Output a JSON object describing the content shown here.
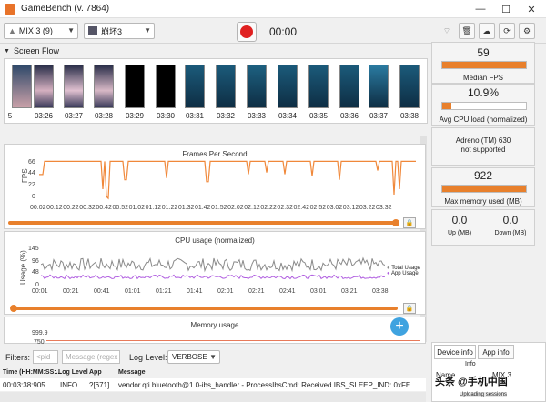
{
  "window": {
    "title": "GameBench (v. 7864)",
    "minimize": "—",
    "maximize": "☐",
    "close": "✕"
  },
  "toolbar": {
    "device": "MIX 3 (9)",
    "app": "崩坏3",
    "timer": "00:00",
    "icons": [
      "wifi-icon",
      "trash-icon",
      "upload-cloud-icon",
      "sync-icon",
      "settings-icon"
    ]
  },
  "screen_flow": {
    "label": "Screen Flow",
    "frames": [
      "5",
      "03:26",
      "03:27",
      "03:28",
      "03:29",
      "03:30",
      "03:31",
      "03:32",
      "03:33",
      "03:34",
      "03:35",
      "03:36",
      "03:37",
      "03:38"
    ]
  },
  "fps_chart": {
    "title": "Frames Per Second",
    "ylabel": "FPS",
    "y_ticks": [
      "66",
      "44",
      "22",
      "0"
    ],
    "x_ticks": [
      "00:02",
      "00:12",
      "00:22",
      "00:32",
      "00:42",
      "00:52",
      "01:02",
      "01:12",
      "01:22",
      "01:32",
      "01:42",
      "01:52",
      "02:02",
      "02:12",
      "02:22",
      "02:32",
      "02:42",
      "02:52",
      "03:02",
      "03:12",
      "03:22",
      "03:32"
    ]
  },
  "cpu_chart": {
    "title": "CPU usage (normalized)",
    "ylabel": "Usage (%)",
    "y_ticks": [
      "145",
      "96",
      "48",
      "0"
    ],
    "x_ticks": [
      "00:01",
      "00:21",
      "00:41",
      "01:01",
      "01:21",
      "01:41",
      "02:01",
      "02:21",
      "02:41",
      "03:01",
      "03:21",
      "03:38"
    ],
    "legend": [
      "Total Usage",
      "App Usage"
    ],
    "colors": {
      "total": "#8a8a8a",
      "app": "#b05ee0"
    }
  },
  "memory_chart": {
    "title": "Memory usage",
    "y_ticks": [
      "999.9",
      "750"
    ]
  },
  "metrics": {
    "fps": {
      "value": "59",
      "label": "Median FPS",
      "fill": 1.0
    },
    "cpu": {
      "value": "10.9%",
      "label": "Avg CPU load (normalized)",
      "fill": 0.109
    },
    "gpu": {
      "line1": "Adreno (TM) 630",
      "line2": "not supported"
    },
    "memory": {
      "value": "922",
      "label": "Max memory used (MB)",
      "fill": 1.0
    },
    "network": {
      "up": "0.0",
      "up_label": "Up (MB)",
      "down": "0.0",
      "down_label": "Down (MB)"
    }
  },
  "filters": {
    "label": "Filters:",
    "pid_placeholder": "<pid",
    "message_placeholder": "Message (regex",
    "log_level_label": "Log Level:",
    "log_level": "VERBOSE"
  },
  "log": {
    "headers": [
      "Time (HH:MM:SS:...",
      "Log Level",
      "App",
      "Message"
    ],
    "rows": [
      {
        "time": "00:03:38:905",
        "level": "INFO",
        "app": "?[671]",
        "message": "vendor.qti.bluetooth@1.0-ibs_handler - ProcessIbsCmd: Received IBS_SLEEP_IND: 0xFE"
      }
    ]
  },
  "device_info": {
    "tabs": [
      "Device info",
      "App info"
    ],
    "header": "Info",
    "name_label": "Name",
    "name_value": "MIX 3",
    "status": "Uploading sessions"
  },
  "watermark": "头条 @手机中国",
  "accent": "#e8802c"
}
